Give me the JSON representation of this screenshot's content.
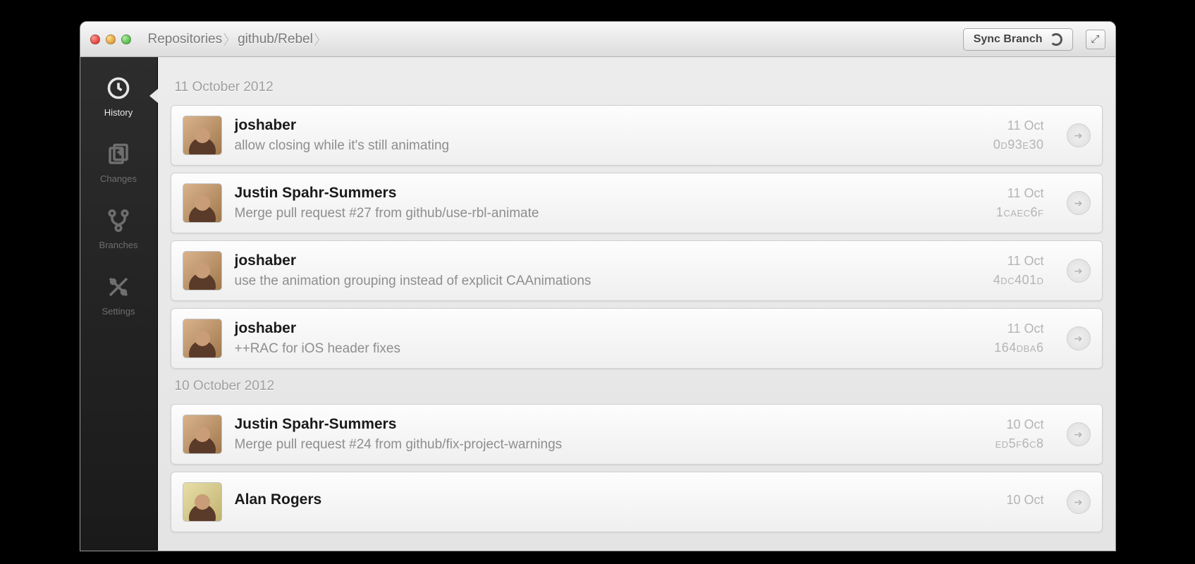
{
  "titlebar": {
    "breadcrumbs": [
      "Repositories",
      "github/Rebel"
    ],
    "sync_label": "Sync Branch"
  },
  "sidebar": {
    "items": [
      {
        "id": "history",
        "label": "History",
        "active": true
      },
      {
        "id": "changes",
        "label": "Changes",
        "active": false
      },
      {
        "id": "branches",
        "label": "Branches",
        "active": false
      },
      {
        "id": "settings",
        "label": "Settings",
        "active": false
      }
    ]
  },
  "history": {
    "groups": [
      {
        "date": "11 October 2012",
        "commits": [
          {
            "author": "joshaber",
            "message": "allow closing while it's still animating",
            "short_date": "11 Oct",
            "sha": "0d93e30",
            "avatar": "a"
          },
          {
            "author": "Justin Spahr-Summers",
            "message": "Merge pull request #27 from github/use-rbl-animate",
            "short_date": "11 Oct",
            "sha": "1caec6f",
            "avatar": "a"
          },
          {
            "author": "joshaber",
            "message": "use the animation grouping instead of explicit CAAnimations",
            "short_date": "11 Oct",
            "sha": "4dc401d",
            "avatar": "a"
          },
          {
            "author": "joshaber",
            "message": "++RAC for iOS header fixes",
            "short_date": "11 Oct",
            "sha": "164dba6",
            "avatar": "a"
          }
        ]
      },
      {
        "date": "10 October 2012",
        "commits": [
          {
            "author": "Justin Spahr-Summers",
            "message": "Merge pull request #24 from github/fix-project-warnings",
            "short_date": "10 Oct",
            "sha": "ed5f6c8",
            "avatar": "a"
          },
          {
            "author": "Alan Rogers",
            "message": "",
            "short_date": "10 Oct",
            "sha": "",
            "avatar": "b"
          }
        ]
      }
    ]
  }
}
